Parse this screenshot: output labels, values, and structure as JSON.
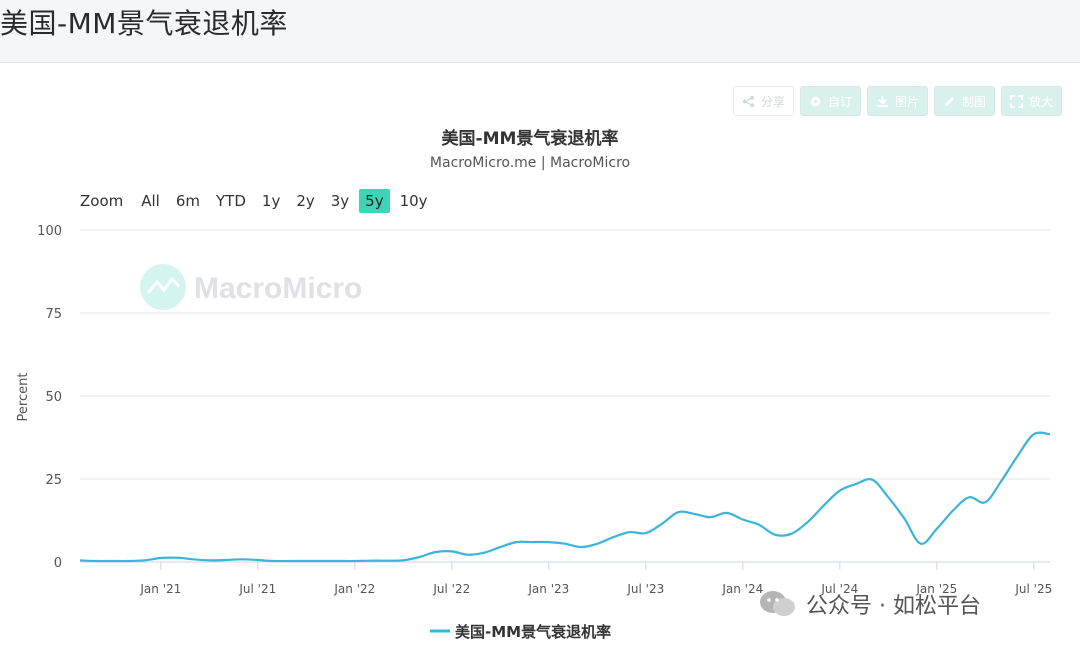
{
  "page": {
    "title": "美国-MM景气衰退机率"
  },
  "toolbar": {
    "share": "分享",
    "custom": "自订",
    "image": "图片",
    "draw": "制图",
    "zoom_out": "放大"
  },
  "zoom": {
    "label": "Zoom",
    "options": [
      "All",
      "6m",
      "YTD",
      "1y",
      "2y",
      "3y",
      "5y",
      "10y"
    ],
    "active": "5y"
  },
  "watermark": {
    "logo_text": "MacroMicro",
    "wechat_text": "公众号 · 如松平台"
  },
  "colors": {
    "series": "#3ab4d9",
    "accent": "#3ed4b8",
    "grid": "#e6e6e6"
  },
  "chart_data": {
    "type": "line",
    "title": "美国-MM景气衰退机率",
    "subtitle": "MacroMicro.me | MacroMicro",
    "ylabel": "Percent",
    "xlabel": "",
    "ylim": [
      0,
      100
    ],
    "yticks": [
      0,
      25,
      50,
      75,
      100
    ],
    "xtick_labels": [
      "Jan '21",
      "Jul '21",
      "Jan '22",
      "Jul '22",
      "Jan '23",
      "Jul '23",
      "Jan '24",
      "Jul '24",
      "Jan '25",
      "Jul '25"
    ],
    "xtick_dates": [
      "2021-01",
      "2021-07",
      "2022-01",
      "2022-07",
      "2023-01",
      "2023-07",
      "2024-01",
      "2024-07",
      "2025-01",
      "2025-07"
    ],
    "xlim": [
      "2020-08",
      "2025-08"
    ],
    "legend": "bottom-center",
    "series": [
      {
        "name": "美国-MM景气衰退机率",
        "x": [
          "2020-08",
          "2020-09",
          "2020-10",
          "2020-11",
          "2020-12",
          "2021-01",
          "2021-02",
          "2021-03",
          "2021-04",
          "2021-05",
          "2021-06",
          "2021-07",
          "2021-08",
          "2021-09",
          "2021-10",
          "2021-11",
          "2021-12",
          "2022-01",
          "2022-02",
          "2022-03",
          "2022-04",
          "2022-05",
          "2022-06",
          "2022-07",
          "2022-08",
          "2022-09",
          "2022-10",
          "2022-11",
          "2022-12",
          "2023-01",
          "2023-02",
          "2023-03",
          "2023-04",
          "2023-05",
          "2023-06",
          "2023-07",
          "2023-08",
          "2023-09",
          "2023-10",
          "2023-11",
          "2023-12",
          "2024-01",
          "2024-02",
          "2024-03",
          "2024-04",
          "2024-05",
          "2024-06",
          "2024-07",
          "2024-08",
          "2024-09",
          "2024-10",
          "2024-11",
          "2024-12",
          "2025-01",
          "2025-02",
          "2025-03",
          "2025-04",
          "2025-05",
          "2025-06",
          "2025-07",
          "2025-08"
        ],
        "values": [
          0.5,
          0.3,
          0.3,
          0.3,
          0.5,
          1.2,
          1.3,
          0.8,
          0.5,
          0.6,
          0.8,
          0.6,
          0.3,
          0.3,
          0.3,
          0.3,
          0.3,
          0.3,
          0.4,
          0.4,
          0.5,
          1.5,
          3.0,
          3.2,
          2.2,
          2.8,
          4.5,
          6.0,
          6.0,
          6.0,
          5.5,
          4.5,
          5.5,
          7.5,
          9.0,
          8.7,
          11.5,
          15.0,
          14.5,
          13.5,
          14.8,
          12.8,
          11.2,
          8.2,
          8.5,
          12.0,
          17.0,
          21.5,
          23.5,
          24.8,
          19.5,
          13.0,
          5.5,
          10.0,
          15.5,
          19.5,
          18.0,
          24.5,
          32.0,
          38.5,
          38.5
        ]
      }
    ]
  }
}
